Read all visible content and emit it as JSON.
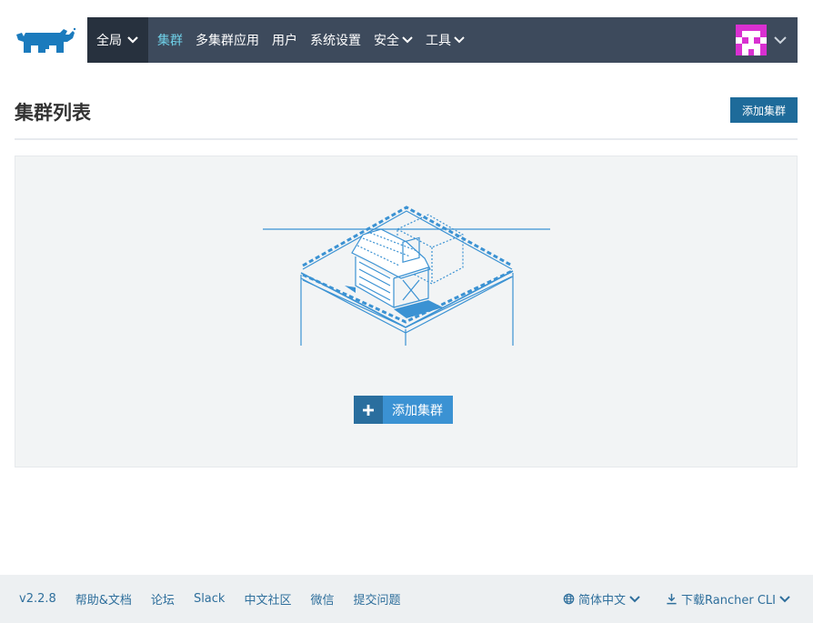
{
  "nav": {
    "scope_label": "全局",
    "items": [
      {
        "label": "集群",
        "active": true
      },
      {
        "label": "多集群应用",
        "active": false
      },
      {
        "label": "用户",
        "active": false
      },
      {
        "label": "系统设置",
        "active": false
      },
      {
        "label": "安全",
        "active": false,
        "dropdown": true
      },
      {
        "label": "工具",
        "active": false,
        "dropdown": true
      }
    ]
  },
  "page": {
    "title": "集群列表",
    "add_cluster_button": "添加集群"
  },
  "empty_state": {
    "add_cluster_button": "添加集群"
  },
  "footer": {
    "version": "v2.2.8",
    "links": [
      "帮助&文档",
      "论坛",
      "Slack",
      "中文社区",
      "微信",
      "提交问题"
    ],
    "language": "简体中文",
    "download_cli": "下载Rancher CLI"
  },
  "colors": {
    "nav_bg": "#3d4a5c",
    "nav_scope_bg": "#27313e",
    "active_link": "#6fd0e8",
    "primary_button": "#1e6b9a",
    "link": "#2f6f9c",
    "avatar_accent": "#d930d1"
  },
  "icons": [
    "rancher-logo-icon",
    "chevron-down-icon",
    "plus-icon",
    "globe-icon",
    "download-icon",
    "avatar-identicon"
  ]
}
